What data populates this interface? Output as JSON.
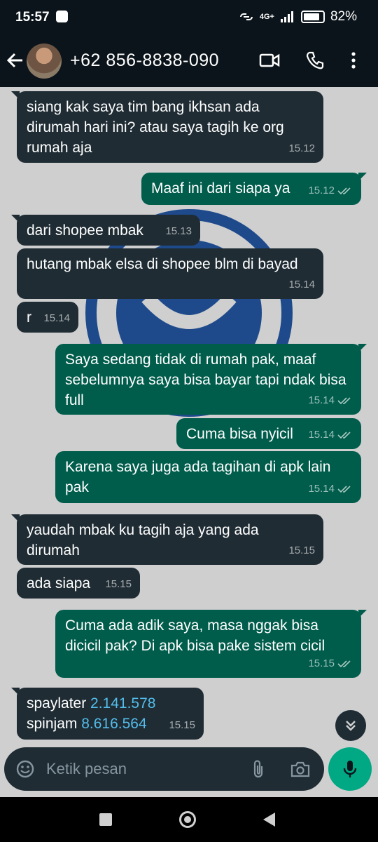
{
  "status": {
    "time": "15:57",
    "network": "4G+",
    "battery": "82%"
  },
  "header": {
    "contact": "+62 856-8838-090"
  },
  "messages": [
    {
      "dir": "in",
      "text": "siang kak saya tim bang ikhsan ada dirumah hari ini? atau saya tagih ke org rumah aja",
      "time": "15.12"
    },
    {
      "dir": "out",
      "text": "Maaf ini dari siapa ya",
      "time": "15.12"
    },
    {
      "dir": "in",
      "text": "dari shopee mbak",
      "time": "15.13"
    },
    {
      "dir": "in",
      "text": "hutang mbak elsa di shopee blm di bayad",
      "time": "15.14"
    },
    {
      "dir": "in",
      "text": "r",
      "time": "15.14"
    },
    {
      "dir": "out",
      "text": "Saya sedang tidak di rumah pak, maaf sebelumnya saya bisa bayar tapi ndak bisa full",
      "time": "15.14"
    },
    {
      "dir": "out",
      "text": "Cuma bisa nyicil",
      "time": "15.14"
    },
    {
      "dir": "out",
      "text": "Karena saya juga ada tagihan di apk lain pak",
      "time": "15.14"
    },
    {
      "dir": "in",
      "text": "yaudah mbak ku tagih aja yang ada dirumah",
      "time": "15.15"
    },
    {
      "dir": "in",
      "text": "ada siapa",
      "time": "15.15"
    },
    {
      "dir": "out",
      "text": "Cuma ada adik saya, masa nggak bisa dicicil pak? Di apk bisa pake sistem cicil",
      "time": "15.15"
    },
    {
      "dir": "in",
      "line1_label": "spaylater ",
      "line1_value": "2.141.578",
      "line2_label": "spinjam ",
      "line2_value": "8.616.564",
      "time": "15.15"
    }
  ],
  "input": {
    "placeholder": "Ketik pesan"
  },
  "colors": {
    "incoming": "#1f2c34",
    "outgoing": "#005c4b",
    "accent": "#00a884",
    "link": "#53bdeb"
  }
}
